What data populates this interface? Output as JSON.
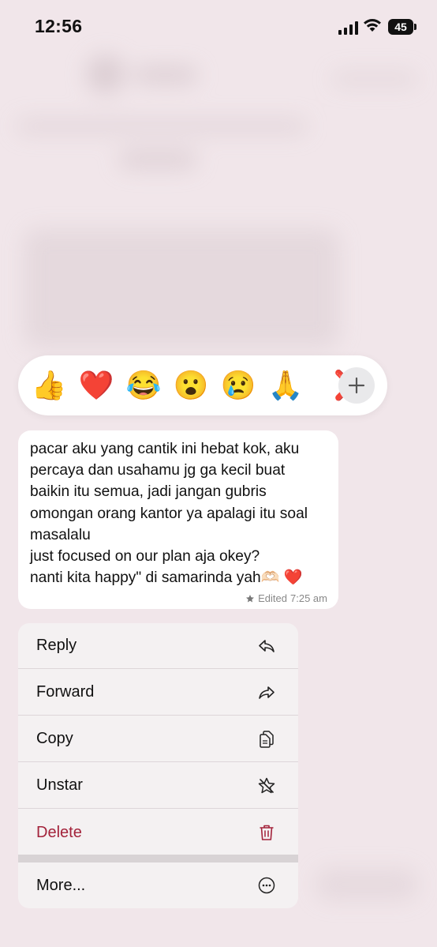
{
  "status_bar": {
    "time": "12:56",
    "battery": "45"
  },
  "reactions": {
    "emojis": [
      "👍",
      "❤️",
      "😂",
      "😮",
      "😢",
      "🙏",
      "❌"
    ],
    "add_label": "+"
  },
  "message": {
    "lines": [
      "pacar aku yang cantik ini hebat kok, aku",
      "percaya dan usahamu jg ga kecil buat",
      "baikin itu semua, jadi jangan gubris",
      "omongan orang kantor ya apalagi itu soal",
      "masalalu",
      "just focused on our plan aja okey?",
      "nanti kita happy\" di samarinda yah🫶🏻 ❤️"
    ],
    "edited_label": "Edited",
    "time": "7:25 am"
  },
  "menu": {
    "reply": "Reply",
    "forward": "Forward",
    "copy": "Copy",
    "unstar": "Unstar",
    "delete": "Delete",
    "more": "More..."
  },
  "colors": {
    "danger": "#a3233b",
    "background": "#f1e6ea"
  }
}
